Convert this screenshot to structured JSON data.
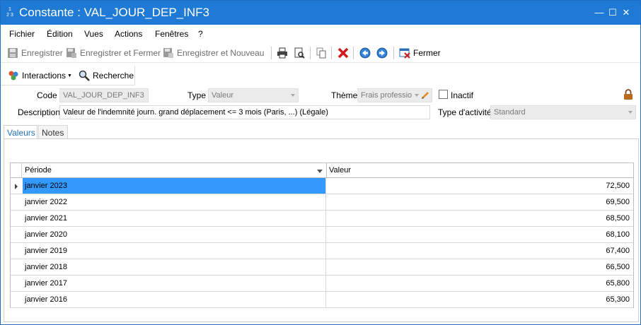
{
  "window": {
    "title": "Constante : VAL_JOUR_DEP_INF3",
    "icon_text": [
      "1",
      "2 3"
    ],
    "controls": {
      "minimize": "—",
      "maximize": "☐",
      "close": "✕"
    }
  },
  "menu": [
    "Fichier",
    "Édition",
    "Vues",
    "Actions",
    "Fenêtres",
    "?"
  ],
  "toolbar": {
    "save": "Enregistrer",
    "save_close": "Enregistrer et Fermer",
    "save_new": "Enregistrer et Nouveau",
    "close": "Fermer"
  },
  "toolbar2": {
    "interactions": "Interactions",
    "search": "Recherche"
  },
  "form": {
    "code_label": "Code",
    "code_value": "VAL_JOUR_DEP_INF3",
    "type_label": "Type",
    "type_value": "Valeur",
    "theme_label": "Thème",
    "theme_value": "Frais professio",
    "inactive_label": "Inactif",
    "inactive_checked": false,
    "description_label": "Description",
    "description_value": "Valeur de l'indemnité journ. grand déplacement <= 3 mois (Paris, ...) (Légale)",
    "activity_label": "Type d'activité",
    "activity_value": "Standard"
  },
  "tabs": [
    {
      "label": "Valeurs",
      "active": true
    },
    {
      "label": "Notes",
      "active": false
    }
  ],
  "grid": {
    "columns": [
      "Période",
      "Valeur"
    ],
    "rows": [
      {
        "period": "janvier 2023",
        "value": "72,500",
        "selected": true
      },
      {
        "period": "janvier 2022",
        "value": "69,500"
      },
      {
        "period": "janvier 2021",
        "value": "68,500"
      },
      {
        "period": "janvier 2020",
        "value": "68,100"
      },
      {
        "period": "janvier 2019",
        "value": "67,400"
      },
      {
        "period": "janvier 2018",
        "value": "66,500"
      },
      {
        "period": "janvier 2017",
        "value": "65,800"
      },
      {
        "period": "janvier 2016",
        "value": "65,300"
      }
    ]
  },
  "colors": {
    "titlebar": "#1f7ad6",
    "selection": "#3399ff",
    "tab_active_text": "#1f6fb6"
  }
}
